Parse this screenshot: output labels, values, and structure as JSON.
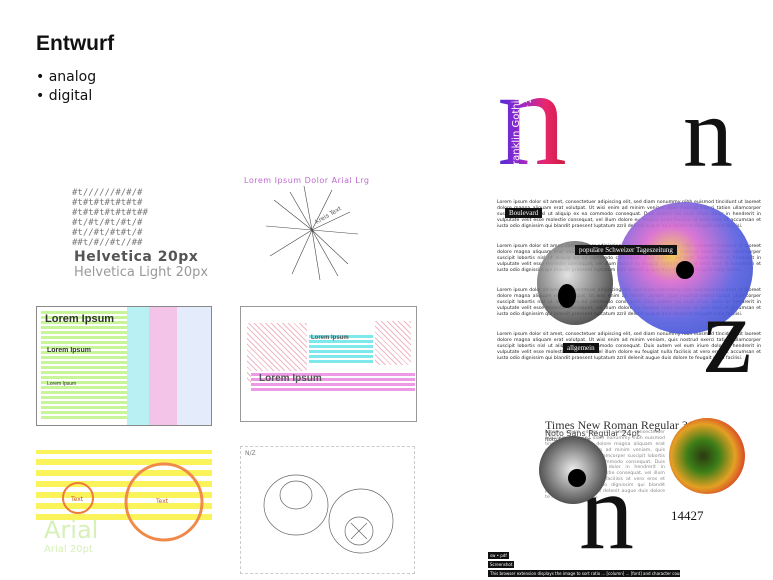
{
  "slide": {
    "title": "Entwurf",
    "bullets": [
      "analog",
      "digital"
    ]
  },
  "sketches": {
    "helvetica_bold": "Helvetica 20px",
    "helvetica_light": "Helvetica Light 20px",
    "top_scribble": "Lorem Ipsum Dolor Arial Lrg",
    "radial_label": "Kreis Text",
    "ipsum_title": "Lorem Ipsum",
    "ipsum_sub": "Lorem Ipsum",
    "ipsum_small": "Lorem Ipsum",
    "pink_box": "Lorem Ipsum",
    "cyan_box": "Lorem Ipsum",
    "circle_small": "Text",
    "circle_large": "Text",
    "arial_label": "Arial",
    "arial_size": "Arial 20pt",
    "sketch_label": "N/Z"
  },
  "digital": {
    "vertical_label_1": "Franklin Gothic Medium 5",
    "vertical_label_2": "Noto Sans Regular 24pt",
    "big_letter_1": "n",
    "big_letter_2": "n",
    "tags": [
      "Boulevard",
      "populäre Schweizer Tageszeitung",
      "allgemein"
    ],
    "big_z": "z",
    "lorem": "Lorem ipsum dolor sit amet, consectetuer adipiscing elit, sed diam nonummy nibh euismod tincidunt ut laoreet dolore magna aliquam erat volutpat. Ut wisi enim ad minim veniam, quis nostrud exerci tation ullamcorper suscipit lobortis nisl ut aliquip ex ea commodo consequat. Duis autem vel eum iriure dolor in hendrerit in vulputate velit esse molestie consequat, vel illum dolore eu feugiat nulla facilisis at vero eros et accumsan et iusto odio dignissim qui blandit praesent luptatum zzril delenit augue duis dolore te feugait nulla facilisi.",
    "caption_serif": "Times New Roman Regular 36pt",
    "caption_sans": "Noto Sans Regular 24pt",
    "caption_small": "Noto Sans Regular",
    "number": "14427",
    "bottom_letter": "n",
    "bar_1": "sw • pdf",
    "bar_2": "Screenshot",
    "bar_3": "This browser extension displays the image to sort ratio ... [column] ... [font] and character count of the visited web page"
  }
}
